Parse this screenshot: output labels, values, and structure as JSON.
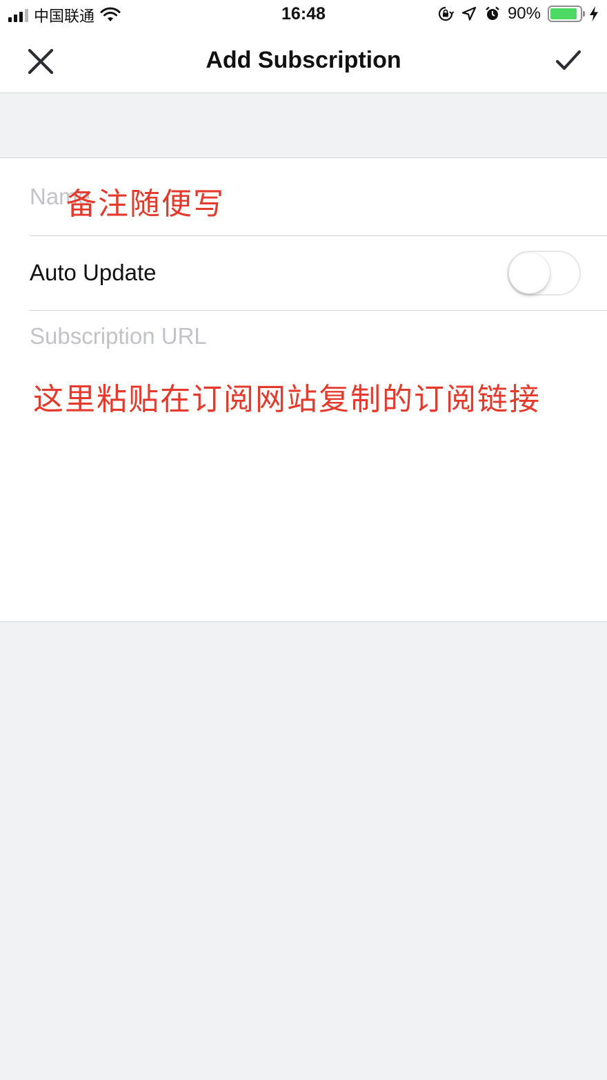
{
  "status_bar": {
    "carrier": "中国联通",
    "time": "16:48",
    "battery_percent": "90%",
    "battery_level": 0.9,
    "icons": [
      "signal-icon",
      "wifi-icon",
      "orientation-lock-icon",
      "location-icon",
      "alarm-icon",
      "battery-icon",
      "charging-icon"
    ]
  },
  "nav": {
    "title": "Add Subscription",
    "close_icon": "close-icon",
    "done_icon": "checkmark-icon"
  },
  "form": {
    "name_placeholder": "Name",
    "name_value": "",
    "auto_update_label": "Auto Update",
    "auto_update_on": false,
    "url_placeholder": "Subscription URL",
    "url_value": ""
  },
  "annotations": {
    "name_note": "备注随便写",
    "url_note": "这里粘贴在订阅网站复制的订阅链接",
    "color": "#e5392b"
  }
}
